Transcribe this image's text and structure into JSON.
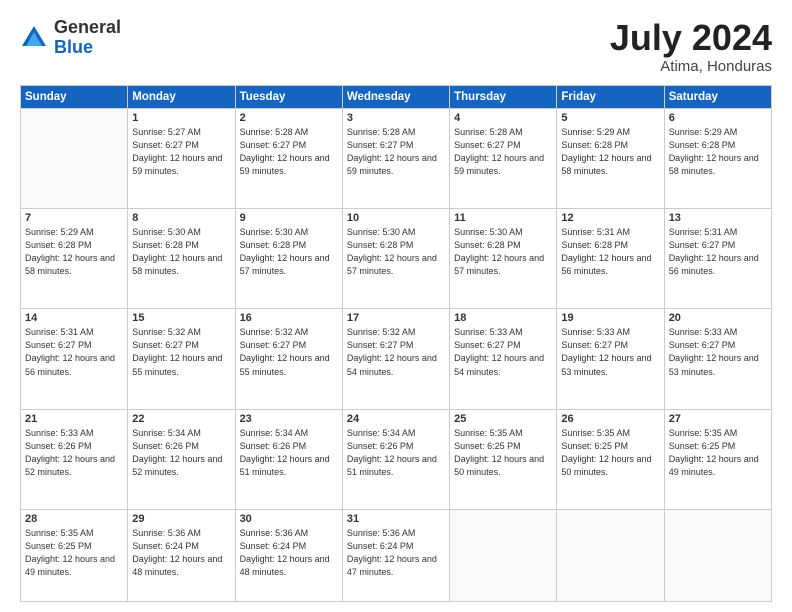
{
  "header": {
    "logo_line1": "General",
    "logo_line2": "Blue",
    "title": "July 2024",
    "location": "Atima, Honduras"
  },
  "columns": [
    "Sunday",
    "Monday",
    "Tuesday",
    "Wednesday",
    "Thursday",
    "Friday",
    "Saturday"
  ],
  "weeks": [
    [
      {
        "day": "",
        "empty": true
      },
      {
        "day": "1",
        "sunrise": "Sunrise: 5:27 AM",
        "sunset": "Sunset: 6:27 PM",
        "daylight": "Daylight: 12 hours and 59 minutes."
      },
      {
        "day": "2",
        "sunrise": "Sunrise: 5:28 AM",
        "sunset": "Sunset: 6:27 PM",
        "daylight": "Daylight: 12 hours and 59 minutes."
      },
      {
        "day": "3",
        "sunrise": "Sunrise: 5:28 AM",
        "sunset": "Sunset: 6:27 PM",
        "daylight": "Daylight: 12 hours and 59 minutes."
      },
      {
        "day": "4",
        "sunrise": "Sunrise: 5:28 AM",
        "sunset": "Sunset: 6:27 PM",
        "daylight": "Daylight: 12 hours and 59 minutes."
      },
      {
        "day": "5",
        "sunrise": "Sunrise: 5:29 AM",
        "sunset": "Sunset: 6:28 PM",
        "daylight": "Daylight: 12 hours and 58 minutes."
      },
      {
        "day": "6",
        "sunrise": "Sunrise: 5:29 AM",
        "sunset": "Sunset: 6:28 PM",
        "daylight": "Daylight: 12 hours and 58 minutes."
      }
    ],
    [
      {
        "day": "7",
        "sunrise": "Sunrise: 5:29 AM",
        "sunset": "Sunset: 6:28 PM",
        "daylight": "Daylight: 12 hours and 58 minutes."
      },
      {
        "day": "8",
        "sunrise": "Sunrise: 5:30 AM",
        "sunset": "Sunset: 6:28 PM",
        "daylight": "Daylight: 12 hours and 58 minutes."
      },
      {
        "day": "9",
        "sunrise": "Sunrise: 5:30 AM",
        "sunset": "Sunset: 6:28 PM",
        "daylight": "Daylight: 12 hours and 57 minutes."
      },
      {
        "day": "10",
        "sunrise": "Sunrise: 5:30 AM",
        "sunset": "Sunset: 6:28 PM",
        "daylight": "Daylight: 12 hours and 57 minutes."
      },
      {
        "day": "11",
        "sunrise": "Sunrise: 5:30 AM",
        "sunset": "Sunset: 6:28 PM",
        "daylight": "Daylight: 12 hours and 57 minutes."
      },
      {
        "day": "12",
        "sunrise": "Sunrise: 5:31 AM",
        "sunset": "Sunset: 6:28 PM",
        "daylight": "Daylight: 12 hours and 56 minutes."
      },
      {
        "day": "13",
        "sunrise": "Sunrise: 5:31 AM",
        "sunset": "Sunset: 6:27 PM",
        "daylight": "Daylight: 12 hours and 56 minutes."
      }
    ],
    [
      {
        "day": "14",
        "sunrise": "Sunrise: 5:31 AM",
        "sunset": "Sunset: 6:27 PM",
        "daylight": "Daylight: 12 hours and 56 minutes."
      },
      {
        "day": "15",
        "sunrise": "Sunrise: 5:32 AM",
        "sunset": "Sunset: 6:27 PM",
        "daylight": "Daylight: 12 hours and 55 minutes."
      },
      {
        "day": "16",
        "sunrise": "Sunrise: 5:32 AM",
        "sunset": "Sunset: 6:27 PM",
        "daylight": "Daylight: 12 hours and 55 minutes."
      },
      {
        "day": "17",
        "sunrise": "Sunrise: 5:32 AM",
        "sunset": "Sunset: 6:27 PM",
        "daylight": "Daylight: 12 hours and 54 minutes."
      },
      {
        "day": "18",
        "sunrise": "Sunrise: 5:33 AM",
        "sunset": "Sunset: 6:27 PM",
        "daylight": "Daylight: 12 hours and 54 minutes."
      },
      {
        "day": "19",
        "sunrise": "Sunrise: 5:33 AM",
        "sunset": "Sunset: 6:27 PM",
        "daylight": "Daylight: 12 hours and 53 minutes."
      },
      {
        "day": "20",
        "sunrise": "Sunrise: 5:33 AM",
        "sunset": "Sunset: 6:27 PM",
        "daylight": "Daylight: 12 hours and 53 minutes."
      }
    ],
    [
      {
        "day": "21",
        "sunrise": "Sunrise: 5:33 AM",
        "sunset": "Sunset: 6:26 PM",
        "daylight": "Daylight: 12 hours and 52 minutes."
      },
      {
        "day": "22",
        "sunrise": "Sunrise: 5:34 AM",
        "sunset": "Sunset: 6:26 PM",
        "daylight": "Daylight: 12 hours and 52 minutes."
      },
      {
        "day": "23",
        "sunrise": "Sunrise: 5:34 AM",
        "sunset": "Sunset: 6:26 PM",
        "daylight": "Daylight: 12 hours and 51 minutes."
      },
      {
        "day": "24",
        "sunrise": "Sunrise: 5:34 AM",
        "sunset": "Sunset: 6:26 PM",
        "daylight": "Daylight: 12 hours and 51 minutes."
      },
      {
        "day": "25",
        "sunrise": "Sunrise: 5:35 AM",
        "sunset": "Sunset: 6:25 PM",
        "daylight": "Daylight: 12 hours and 50 minutes."
      },
      {
        "day": "26",
        "sunrise": "Sunrise: 5:35 AM",
        "sunset": "Sunset: 6:25 PM",
        "daylight": "Daylight: 12 hours and 50 minutes."
      },
      {
        "day": "27",
        "sunrise": "Sunrise: 5:35 AM",
        "sunset": "Sunset: 6:25 PM",
        "daylight": "Daylight: 12 hours and 49 minutes."
      }
    ],
    [
      {
        "day": "28",
        "sunrise": "Sunrise: 5:35 AM",
        "sunset": "Sunset: 6:25 PM",
        "daylight": "Daylight: 12 hours and 49 minutes."
      },
      {
        "day": "29",
        "sunrise": "Sunrise: 5:36 AM",
        "sunset": "Sunset: 6:24 PM",
        "daylight": "Daylight: 12 hours and 48 minutes."
      },
      {
        "day": "30",
        "sunrise": "Sunrise: 5:36 AM",
        "sunset": "Sunset: 6:24 PM",
        "daylight": "Daylight: 12 hours and 48 minutes."
      },
      {
        "day": "31",
        "sunrise": "Sunrise: 5:36 AM",
        "sunset": "Sunset: 6:24 PM",
        "daylight": "Daylight: 12 hours and 47 minutes."
      },
      {
        "day": "",
        "empty": true
      },
      {
        "day": "",
        "empty": true
      },
      {
        "day": "",
        "empty": true
      }
    ]
  ]
}
